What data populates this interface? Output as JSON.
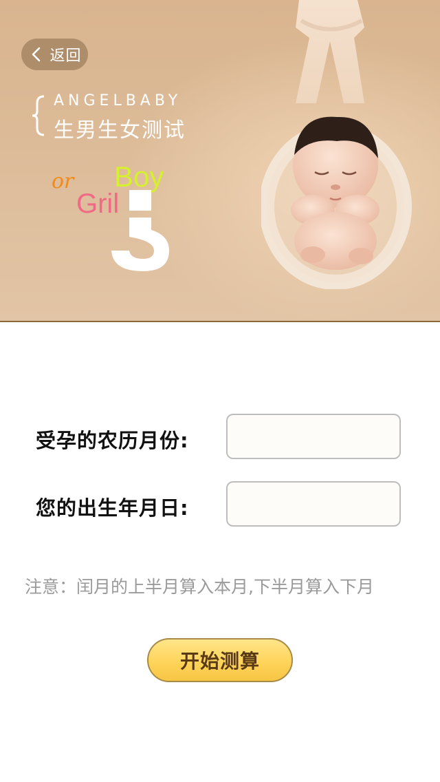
{
  "header": {
    "back_label": "返回",
    "brand": "ANGELBABY",
    "subtitle": "生男生女测试",
    "graphic_words": {
      "or": "or",
      "boy": "Boy",
      "gril": "Gril"
    }
  },
  "form": {
    "conception_month_label": "受孕的农历月份:",
    "conception_month_value": "",
    "birthday_label": "您的出生年月日:",
    "birthday_value": ""
  },
  "note": "注意：闰月的上半月算入本月,下半月算入下月",
  "start_button_label": "开始测算",
  "colors": {
    "accent_button": "#ffd45a",
    "banner_bg": "#dcbb98",
    "or_color": "#f28a1a",
    "boy_color": "#d6ef2e",
    "gril_color": "#f06a86"
  },
  "icons": {
    "back": "chevron-left-icon",
    "question_mark": "question-mark-icon",
    "brace": "left-brace-icon"
  }
}
